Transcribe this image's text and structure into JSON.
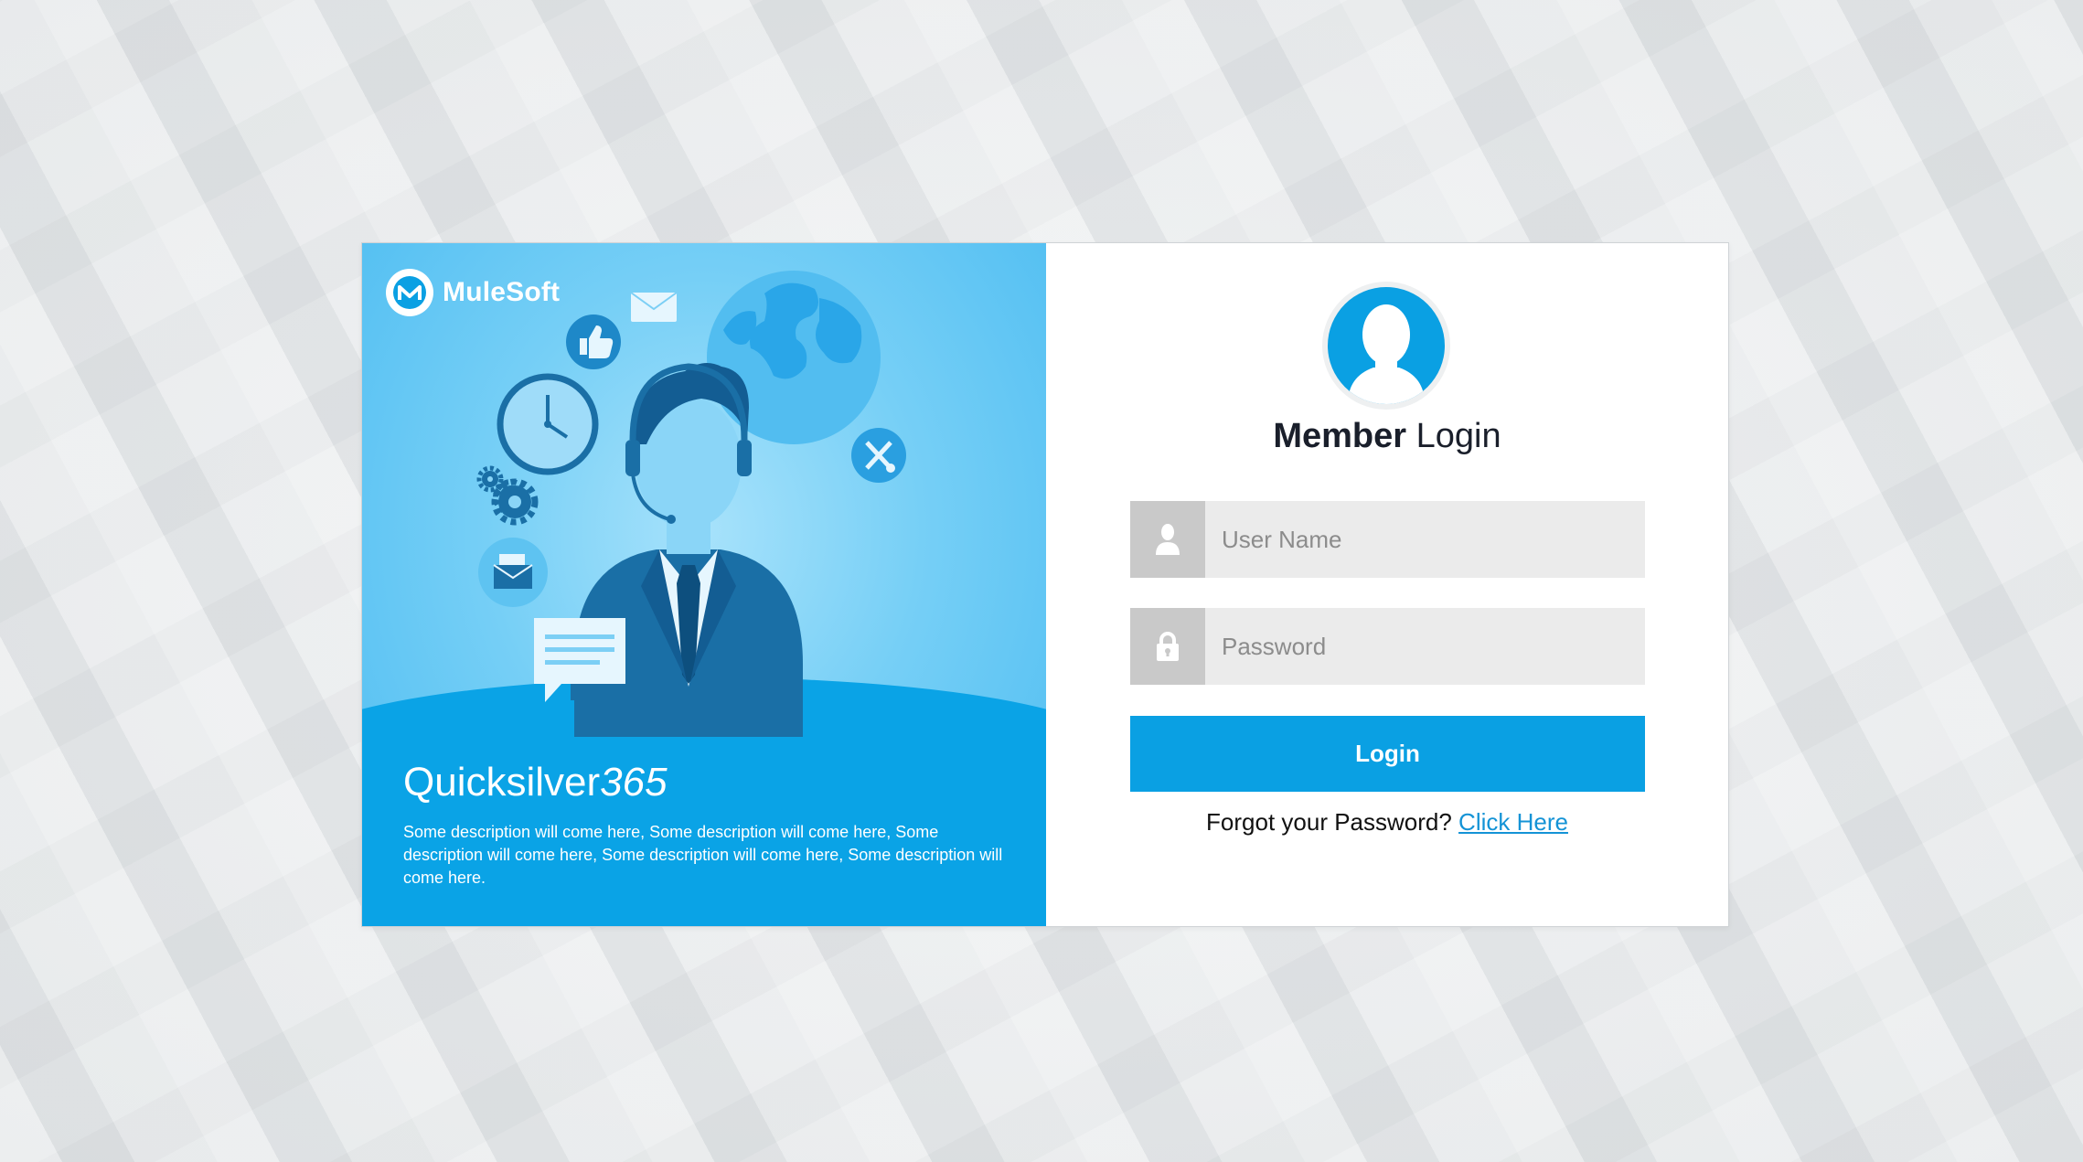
{
  "brand": {
    "logo_text": "MuleSoft"
  },
  "promo": {
    "title_main": "Quicksilver",
    "title_num": "365",
    "description": "Some description will come here, Some description will come here, Some description will come here, Some description will come here, Some description will come here."
  },
  "login": {
    "heading_strong": "Member",
    "heading_rest": " Login",
    "username_placeholder": "User Name",
    "password_placeholder": "Password",
    "login_button": "Login",
    "forgot_text": "Forgot your Password? ",
    "forgot_link": "Click Here"
  },
  "colors": {
    "accent": "#0aa0e3",
    "link": "#1493d6",
    "field_bg": "#ebebeb",
    "icon_box": "#c9c9c9"
  },
  "icons": {
    "username": "user-icon",
    "password": "lock-icon",
    "avatar": "user-avatar-icon",
    "logo": "mulesoft-logo-icon"
  }
}
